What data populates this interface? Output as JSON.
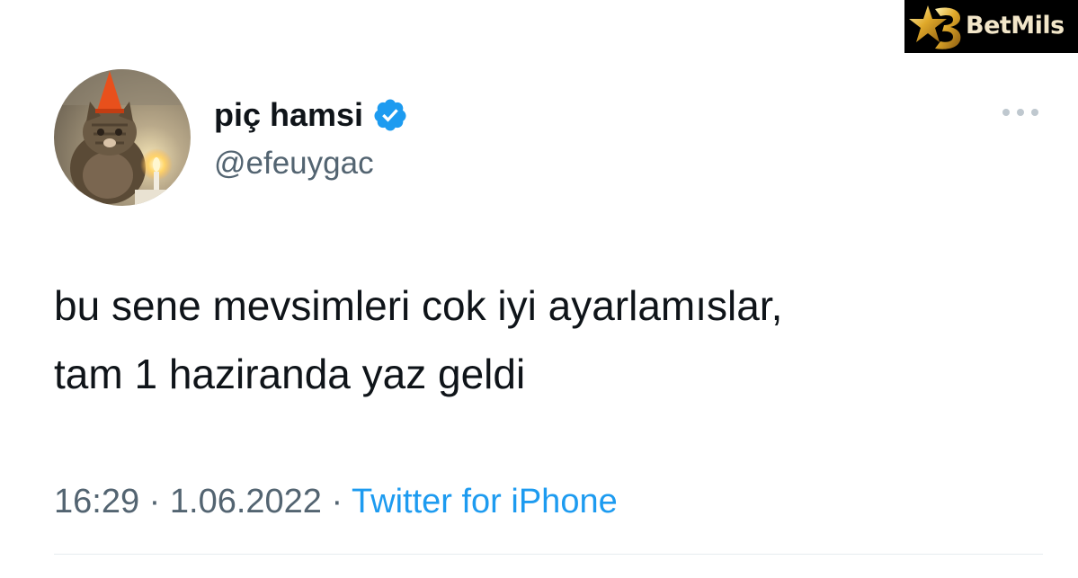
{
  "watermark": {
    "text": "BetMils"
  },
  "author": {
    "display_name": "piç hamsi",
    "handle": "@efeuygac",
    "verified": true,
    "avatar_description": "cat with party cone hat and candle"
  },
  "tweet": {
    "text": "bu sene mevsimleri cok iyi ayarlamıslar,\ntam 1 haziranda yaz geldi",
    "time": "16:29",
    "separator": "·",
    "date": "1.06.2022",
    "source": "Twitter for iPhone"
  },
  "colors": {
    "text_primary": "#0f1419",
    "text_secondary": "#536471",
    "accent_blue": "#1d9bf0"
  },
  "icons": {
    "verified": "verified-badge-icon",
    "more": "more-options-icon"
  }
}
